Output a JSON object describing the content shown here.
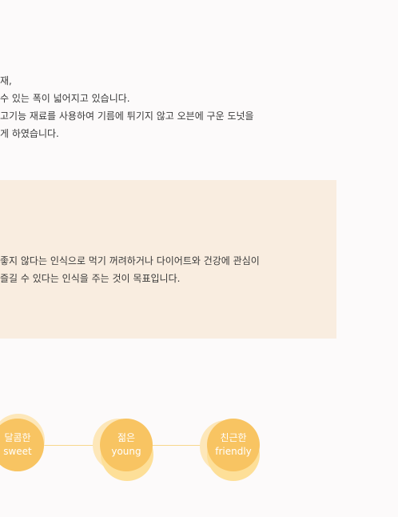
{
  "intro": {
    "lines": [
      "재,",
      "수 있는 폭이 넓어지고 있습니다.",
      "고기능 재료를 사용하여 기름에 튀기지 않고 오븐에 구운 도넛을",
      "게 하였습니다."
    ]
  },
  "goal_box": {
    "lines": [
      "좋지 않다는 인식으로 먹기 꺼려하거나 다이어트와 건강에 관심이",
      "즐길 수 있다는 인식을 주는 것이 목표입니다."
    ],
    "background": "#f9ede0"
  },
  "keywords": [
    {
      "ko": "달콤한",
      "en": "sweet"
    },
    {
      "ko": "젊은",
      "en": "young"
    },
    {
      "ko": "친근한",
      "en": "friendly"
    }
  ],
  "colors": {
    "page_background": "#fcfafa",
    "accent_circle": "#f8c462",
    "accent_halo": "#fde7b9",
    "connector_line": "#f7d78d"
  }
}
